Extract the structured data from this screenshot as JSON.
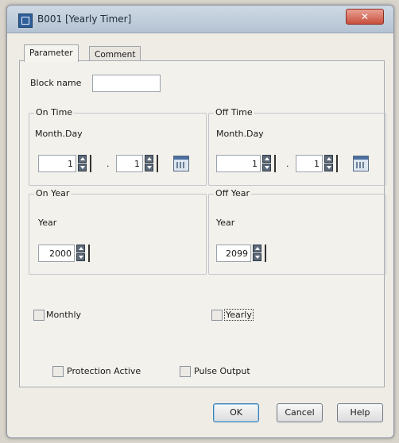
{
  "window": {
    "title": "B001 [Yearly Timer]",
    "close_glyph": "✕"
  },
  "tabs": [
    {
      "label": "Parameter"
    },
    {
      "label": "Comment"
    }
  ],
  "block_name": {
    "label": "Block name",
    "value": ""
  },
  "on_time": {
    "title": "On Time",
    "field_label": "Month.Day",
    "month": "1",
    "separator": ".",
    "day": "1"
  },
  "off_time": {
    "title": "Off Time",
    "field_label": "Month.Day",
    "month": "1",
    "separator": ".",
    "day": "1"
  },
  "on_year": {
    "title": "On Year",
    "field_label": "Year",
    "value": "2000"
  },
  "off_year": {
    "title": "Off Year",
    "field_label": "Year",
    "value": "2099"
  },
  "options": {
    "monthly": "Monthly",
    "yearly": "Yearly",
    "protection_active": "Protection Active",
    "pulse_output": "Pulse Output"
  },
  "buttons": {
    "ok": "OK",
    "cancel": "Cancel",
    "help": "Help"
  },
  "icons": {
    "calendar": "calendar-icon",
    "spin": "spin-arrows-icon"
  },
  "colors": {
    "titlebar": "#b4c3d3",
    "close": "#c8503c",
    "default_button_border": "#3c7fb1"
  }
}
